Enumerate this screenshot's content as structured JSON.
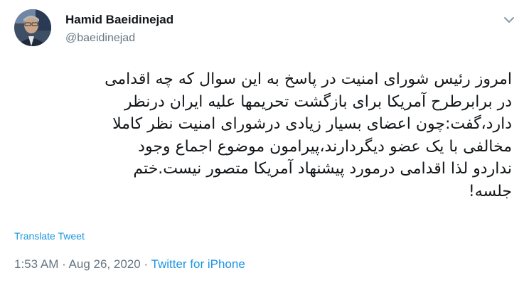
{
  "author": {
    "display_name": "Hamid Baeidinejad",
    "handle": "@baeidinejad"
  },
  "tweet": {
    "lines": [
      "امروز رئیس شورای امنیت در پاسخ به این سوال که چه اقدامی",
      "در برابرطرح آمریکا برای بازگشت تحریمها علیه ایران درنظر",
      "دارد،گفت:چون اعضای بسیار زیادی درشورای امنیت نظر کاملا",
      "مخالفی با یک عضو دیگردارند،پیرامون موضوع اجماع وجود",
      "نداردو لذا اقدامی درمورد پیشنهاد آمریکا متصور نیست.ختم",
      "جلسه!"
    ],
    "translate_label": "Translate Tweet"
  },
  "meta": {
    "time": "1:53 AM",
    "separator1": " · ",
    "date": "Aug 26, 2020",
    "separator2": " · ",
    "source": "Twitter for iPhone"
  },
  "icons": {
    "avatar": "profile-photo",
    "menu": "chevron-down-icon"
  },
  "colors": {
    "text": "#14171a",
    "secondary": "#657786",
    "link": "#1b95e0"
  }
}
